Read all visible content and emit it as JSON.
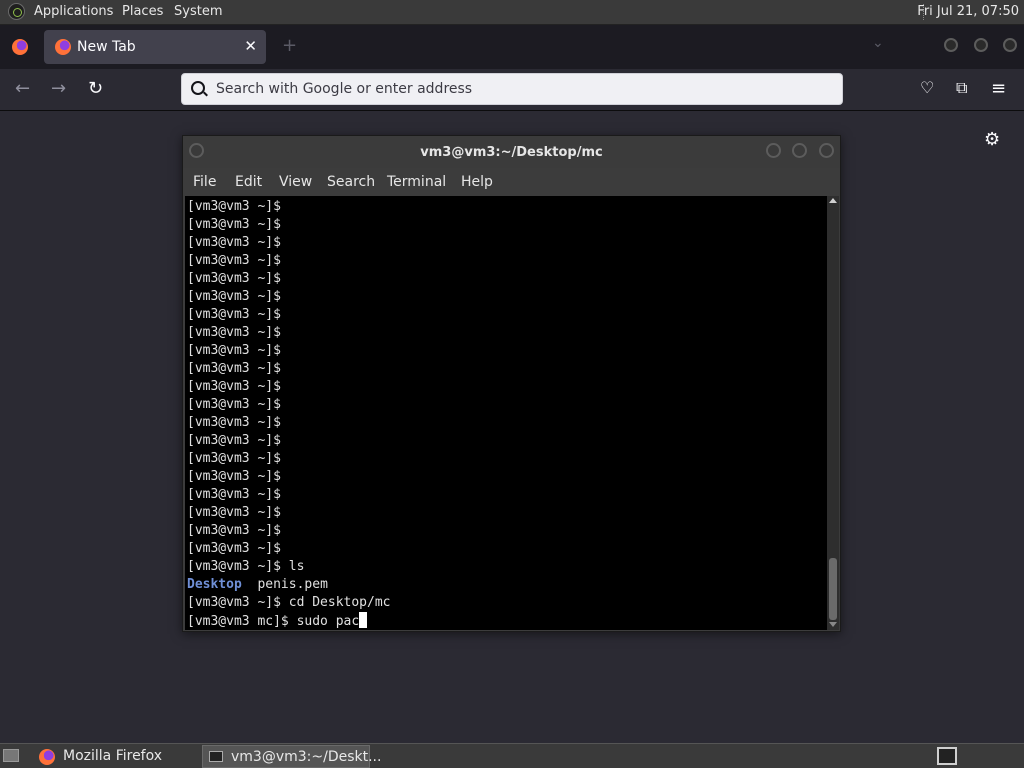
{
  "top_panel": {
    "menus": [
      "Applications",
      "Places",
      "System"
    ],
    "clock": "Fri Jul 21, 07:50"
  },
  "browser": {
    "tab_title": "New Tab",
    "url_placeholder": "Search with Google or enter address"
  },
  "terminal": {
    "title": "vm3@vm3:~/Desktop/mc",
    "menu": [
      "File",
      "Edit",
      "View",
      "Search",
      "Terminal",
      "Help"
    ],
    "prompt_line": "[vm3@vm3 ~]$",
    "empty_prompt_count": 20,
    "ls_command": "[vm3@vm3 ~]$ ls",
    "ls_dir": "Desktop",
    "ls_file": "penis.pem",
    "cd_command": "[vm3@vm3 ~]$ cd Desktop/mc",
    "current_input": "[vm3@vm3 mc]$ sudo pac"
  },
  "taskbar": {
    "items": [
      "Mozilla Firefox",
      "vm3@vm3:~/Deskt..."
    ]
  }
}
